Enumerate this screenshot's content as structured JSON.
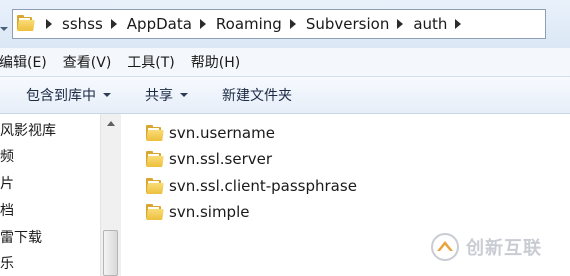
{
  "address_bar": {
    "path": [
      "sshss",
      "AppData",
      "Roaming",
      "Subversion",
      "auth"
    ],
    "icon": "folder-icon"
  },
  "menu": {
    "items": [
      "编辑(E)",
      "查看(V)",
      "工具(T)",
      "帮助(H)"
    ]
  },
  "toolbar": {
    "buttons": [
      {
        "label": "包含到库中",
        "has_dropdown": true
      },
      {
        "label": "共享",
        "has_dropdown": true
      },
      {
        "label": "新建文件夹",
        "has_dropdown": false
      }
    ]
  },
  "navigation": {
    "items": [
      "风影视库",
      "频",
      "片",
      "档",
      "雷下载",
      "乐"
    ]
  },
  "files": {
    "items": [
      {
        "name": "svn.username",
        "icon": "folder-icon"
      },
      {
        "name": "svn.ssl.server",
        "icon": "folder-icon"
      },
      {
        "name": "svn.ssl.client-passphrase",
        "icon": "folder-icon"
      },
      {
        "name": "svn.simple",
        "icon": "folder-icon"
      }
    ]
  },
  "watermark": {
    "text": "创新互联",
    "accent_color": "#e8a33a"
  },
  "colors": {
    "folder": "#eebf3c",
    "toolbar_text": "#1c2a44",
    "address_border": "#8e9fb5"
  }
}
